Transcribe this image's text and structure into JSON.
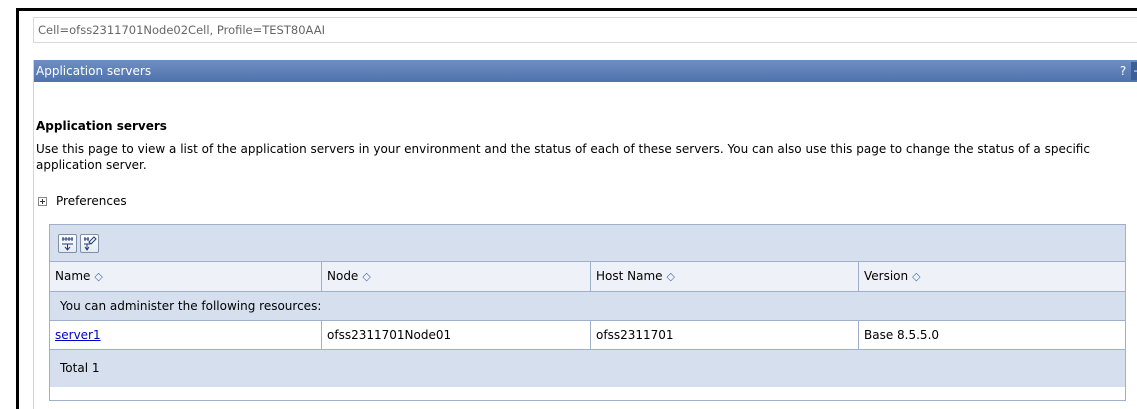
{
  "context": {
    "cell_profile": "Cell=ofss2311701Node02Cell, Profile=TEST80AAI"
  },
  "portlet": {
    "title": "Application servers",
    "help": "?",
    "minimize": "-"
  },
  "content": {
    "heading": "Application servers",
    "description": "Use this page to view a list of the application servers in your environment and the status of each of these servers. You can also use this page to change the status of a specific application server.",
    "preferences_label": "Preferences"
  },
  "toolbar": {
    "buttons": [
      {
        "icon": "select-all-icon"
      },
      {
        "icon": "deselect-all-icon"
      }
    ]
  },
  "table": {
    "columns": [
      "Name",
      "Node",
      "Host Name",
      "Version"
    ],
    "sort_glyph": "◇",
    "group_label": "You can administer the following resources:",
    "rows": [
      {
        "name": "server1",
        "node": "ofss2311701Node01",
        "host": "ofss2311701",
        "version": "Base 8.5.5.0"
      }
    ],
    "total": "Total 1"
  },
  "colors": {
    "titlebar": "#5a7bb5",
    "toolbar": "#d5dfee",
    "link": "#0000cc"
  }
}
